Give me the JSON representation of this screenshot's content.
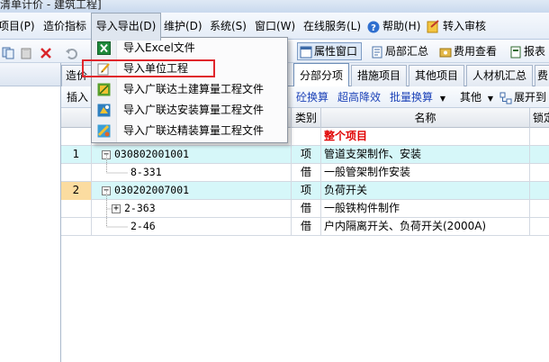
{
  "window": {
    "title": "清单计价 - 建筑工程]"
  },
  "menubar": {
    "items": [
      "项目(P)",
      "造价指标",
      "导入导出(D)",
      "维护(D)",
      "系统(S)",
      "窗口(W)",
      "在线服务(L)",
      "帮助(H)",
      "转入审核"
    ]
  },
  "toolbar": {
    "attr_window": "属性窗口",
    "local_summary": "局部汇总",
    "fee_view": "费用查看",
    "report": "报表"
  },
  "dropdown": {
    "items": [
      {
        "label": "导入Excel文件",
        "icon": "excel-icon"
      },
      {
        "label": "导入单位工程",
        "icon": "edit-file-icon"
      },
      {
        "label": "导入广联达土建算量工程文件",
        "icon": "glodon-civil-icon"
      },
      {
        "label": "导入广联达安装算量工程文件",
        "icon": "glodon-install-icon"
      },
      {
        "label": "导入广联达精装算量工程文件",
        "icon": "glodon-decoration-icon"
      }
    ]
  },
  "tabs": {
    "left_partial": "造价",
    "items": [
      "分部分项",
      "措施项目",
      "其他项目",
      "人材机汇总",
      "费"
    ]
  },
  "subtoolbar": {
    "insert": "插入",
    "convert": "砼换算",
    "overheight": "超高降效",
    "batch": "批量换算",
    "other": "其他",
    "expand": "展开到"
  },
  "grid": {
    "headers": {
      "type": "类别",
      "name": "名称",
      "lock": "锁定"
    },
    "rows": [
      {
        "num": "",
        "code": "",
        "type": "",
        "name": "整个项目",
        "style": "total"
      },
      {
        "num": "1",
        "code": "030802001001",
        "type": "项",
        "name": "管道支架制作、安装",
        "style": "item",
        "expander": "−"
      },
      {
        "num": "",
        "code": "8-331",
        "type": "借",
        "name": "一般管架制作安装",
        "style": "sub"
      },
      {
        "num": "2",
        "code": "030202007001",
        "type": "项",
        "name": "负荷开关",
        "style": "item",
        "expander": "−"
      },
      {
        "num": "",
        "code": "2-363",
        "type": "借",
        "name": "一般铁构件制作",
        "style": "sub",
        "expander": "+"
      },
      {
        "num": "",
        "code": "2-46",
        "type": "借",
        "name": "户内隔离开关、负荷开关(2000A)",
        "style": "sub"
      }
    ]
  },
  "colors": {
    "item_row_bg": "#d6f7f9",
    "total_text": "#e00000",
    "selected_row_num": "#fbdca0",
    "highlight_box": "#e0262c",
    "link_blue": "#1d43b8"
  }
}
